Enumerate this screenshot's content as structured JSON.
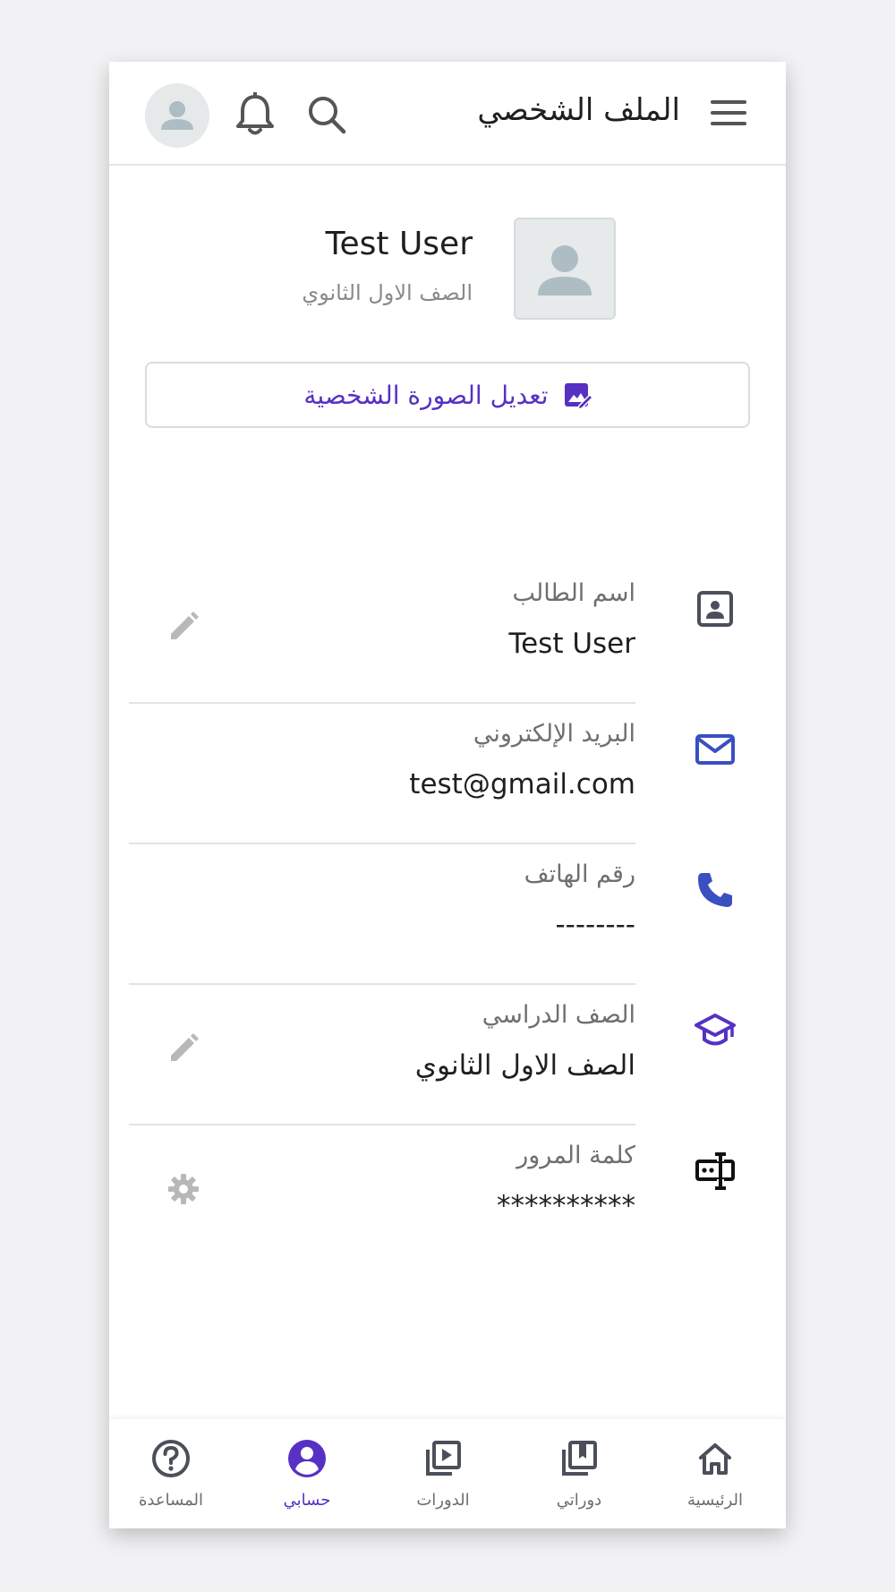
{
  "header": {
    "title": "الملف الشخصي",
    "menu_icon": "hamburger-menu-icon",
    "search_icon": "search-icon",
    "notification_icon": "bell-icon",
    "avatar_icon": "user-avatar-icon"
  },
  "profile": {
    "name": "Test User",
    "grade": "الصف الاول الثانوي",
    "photo_icon": "user-placeholder-icon",
    "edit_photo_label": "تعديل الصورة الشخصية"
  },
  "fields": [
    {
      "label": "اسم الطالب",
      "value": "Test User",
      "icon": "contact-card-icon",
      "action_icon": "pencil-icon"
    },
    {
      "label": "البريد الإلكتروني",
      "value": "test@gmail.com",
      "icon": "mail-icon",
      "action_icon": ""
    },
    {
      "label": "رقم الهاتف",
      "value": "--------",
      "icon": "phone-icon",
      "action_icon": ""
    },
    {
      "label": "الصف الدراسي",
      "value": "الصف الاول الثانوي",
      "icon": "graduation-cap-icon",
      "action_icon": "pencil-icon"
    },
    {
      "label": "كلمة المرور",
      "value": "**********",
      "icon": "password-field-icon",
      "action_icon": "gear-icon"
    }
  ],
  "bottom_nav": [
    {
      "label": "الرئيسية",
      "icon": "home-icon",
      "active": false
    },
    {
      "label": "دوراتي",
      "icon": "my-courses-icon",
      "active": false
    },
    {
      "label": "الدورات",
      "icon": "courses-video-icon",
      "active": false
    },
    {
      "label": "حسابي",
      "icon": "account-icon",
      "active": true
    },
    {
      "label": "المساعدة",
      "icon": "help-icon",
      "active": false
    }
  ],
  "colors": {
    "accent": "#5631c3",
    "icon_blue": "#3a4fc0",
    "text_dark": "#1f1f1f",
    "text_muted": "#6f6f6f",
    "background": "#f2f2f4"
  }
}
